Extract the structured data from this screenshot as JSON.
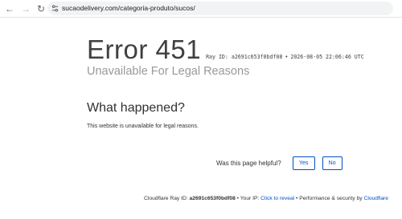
{
  "browser": {
    "url": "sucaodelivery.com/categoria-produto/sucos/",
    "back_icon": "←",
    "forward_icon": "→",
    "reload_icon": "↻"
  },
  "error": {
    "code_text": "Error 451",
    "ray_id_label": "Ray ID:",
    "ray_id": "a2691c653f0bdf08",
    "separator": "•",
    "timestamp": "2026-08-05 22:06:46 UTC",
    "subtitle": "Unavailable For Legal Reasons"
  },
  "what_happened": {
    "heading": "What happened?",
    "body": "This website is unavailable for legal reasons."
  },
  "feedback": {
    "question": "Was this page helpful?",
    "yes_label": "Yes",
    "no_label": "No"
  },
  "footer": {
    "ray_label": "Cloudflare Ray ID:",
    "ray_id": "a2691c653f0bdf08",
    "sep1": "•",
    "ip_label": "Your IP:",
    "ip_link": "Click to reveal",
    "sep2": "•",
    "security_label": "Performance & security by",
    "cloudflare_link": "Cloudflare"
  },
  "colors": {
    "accent": "#0051c3",
    "muted": "#999999",
    "text": "#313131"
  }
}
